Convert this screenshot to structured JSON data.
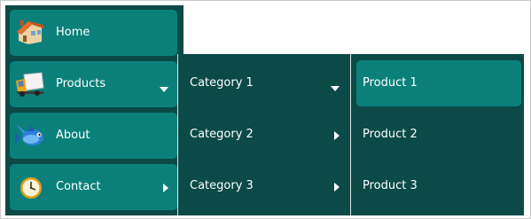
{
  "colors": {
    "menu_background": "#0b4a46",
    "item_background": "#0b807b",
    "text": "#ffffff",
    "frame_border": "#c9c9c9"
  },
  "main_menu": {
    "items": [
      {
        "label": "Home",
        "icon": "house-icon"
      },
      {
        "label": "Products",
        "icon": "truck-icon",
        "indicator": "chevron-down-icon"
      },
      {
        "label": "About",
        "icon": "fish-icon"
      },
      {
        "label": "Contact",
        "icon": "clock-icon",
        "indicator": "chevron-right-icon"
      }
    ]
  },
  "categories_menu": {
    "items": [
      {
        "label": "Category 1",
        "indicator": "chevron-down-icon"
      },
      {
        "label": "Category 2",
        "indicator": "chevron-right-icon"
      },
      {
        "label": "Category 3",
        "indicator": "chevron-right-icon"
      }
    ]
  },
  "products_menu": {
    "items": [
      {
        "label": "Product 1",
        "highlighted": true
      },
      {
        "label": "Product 2",
        "highlighted": false
      },
      {
        "label": "Product 3",
        "highlighted": false
      }
    ]
  }
}
